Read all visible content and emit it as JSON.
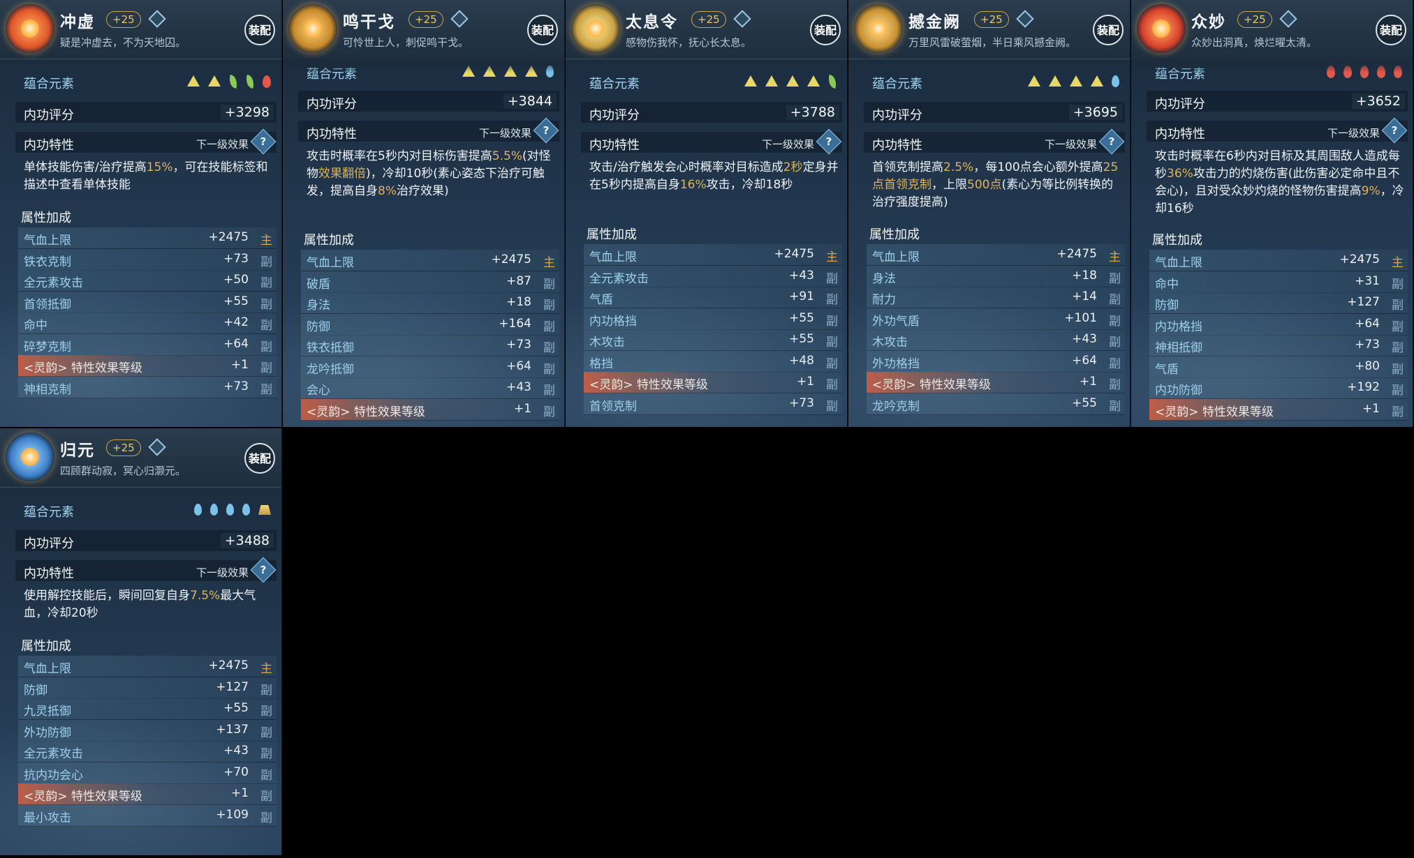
{
  "cards": [
    {
      "name": "冲虚",
      "level": "+25",
      "tagline": "疑是冲虚去，不为天地囚。",
      "equip": "装配",
      "element_label": "蕴合元素",
      "elements": [
        "tri",
        "tri",
        "leaf",
        "leaf",
        "fire"
      ],
      "score_label": "内功评分",
      "score": "+3298",
      "trait_label": "内功特性",
      "next_label": "下一级效果",
      "help": "?",
      "desc": [
        {
          "t": "单体技能伤害/治疗提高"
        },
        {
          "t": "15%",
          "h": true
        },
        {
          "t": "，可在技能标签和描述中查看单体技能"
        }
      ],
      "attr_label": "属性加成",
      "stats": [
        {
          "name": "气血上限",
          "value": "+2475",
          "tag": "主"
        },
        {
          "name": "铁衣克制",
          "value": "+73",
          "tag": "副"
        },
        {
          "name": "全元素攻击",
          "value": "+50",
          "tag": "副"
        },
        {
          "name": "首领抵御",
          "value": "+55",
          "tag": "副"
        },
        {
          "name": "命中",
          "value": "+42",
          "tag": "副"
        },
        {
          "name": "碎梦克制",
          "value": "+64",
          "tag": "副"
        },
        {
          "name": "<灵韵> 特性效果等级",
          "value": "+1",
          "tag": "副",
          "lingyun": true
        },
        {
          "name": "神相克制",
          "value": "+73",
          "tag": "副"
        }
      ]
    },
    {
      "name": "鸣干戈",
      "level": "+25",
      "tagline": "可怜世上人，刺促鸣干戈。",
      "equip": "装配",
      "element_label": "蕴合元素",
      "elements": [
        "tri",
        "tri",
        "tri",
        "tri",
        "drop"
      ],
      "score_label": "内功评分",
      "score": "+3844",
      "trait_label": "内功特性",
      "next_label": "下一级效果",
      "help": "?",
      "desc": [
        {
          "t": "攻击时概率在5秒内对目标伤害提高"
        },
        {
          "t": "5.5%",
          "h": true
        },
        {
          "t": "(对怪物"
        },
        {
          "t": "效果翻倍",
          "h": true
        },
        {
          "t": ")，冷却10秒(素心姿态下治疗可触发，提高自身"
        },
        {
          "t": "8%",
          "h": true
        },
        {
          "t": "治疗效果)"
        }
      ],
      "attr_label": "属性加成",
      "stats": [
        {
          "name": "气血上限",
          "value": "+2475",
          "tag": "主"
        },
        {
          "name": "破盾",
          "value": "+87",
          "tag": "副"
        },
        {
          "name": "身法",
          "value": "+18",
          "tag": "副"
        },
        {
          "name": "防御",
          "value": "+164",
          "tag": "副"
        },
        {
          "name": "铁衣抵御",
          "value": "+73",
          "tag": "副"
        },
        {
          "name": "龙吟抵御",
          "value": "+64",
          "tag": "副"
        },
        {
          "name": "会心",
          "value": "+43",
          "tag": "副"
        },
        {
          "name": "<灵韵> 特性效果等级",
          "value": "+1",
          "tag": "副",
          "lingyun": true
        }
      ]
    },
    {
      "name": "太息令",
      "level": "+25",
      "tagline": "感物伤我怀，抚心长太息。",
      "equip": "装配",
      "element_label": "蕴合元素",
      "elements": [
        "tri",
        "tri",
        "tri",
        "tri",
        "leaf"
      ],
      "score_label": "内功评分",
      "score": "+3788",
      "trait_label": "内功特性",
      "next_label": "下一级效果",
      "help": "?",
      "desc": [
        {
          "t": "攻击/治疗触发会心时概率对目标造成"
        },
        {
          "t": "2秒",
          "h": true
        },
        {
          "t": "定身并在5秒内提高自身"
        },
        {
          "t": "16%",
          "h": true
        },
        {
          "t": "攻击，冷却18秒"
        }
      ],
      "attr_label": "属性加成",
      "stats": [
        {
          "name": "气血上限",
          "value": "+2475",
          "tag": "主"
        },
        {
          "name": "全元素攻击",
          "value": "+43",
          "tag": "副"
        },
        {
          "name": "气盾",
          "value": "+91",
          "tag": "副"
        },
        {
          "name": "内功格挡",
          "value": "+55",
          "tag": "副"
        },
        {
          "name": "木攻击",
          "value": "+55",
          "tag": "副"
        },
        {
          "name": "格挡",
          "value": "+48",
          "tag": "副"
        },
        {
          "name": "<灵韵> 特性效果等级",
          "value": "+1",
          "tag": "副",
          "lingyun": true
        },
        {
          "name": "首领克制",
          "value": "+73",
          "tag": "副"
        }
      ]
    },
    {
      "name": "撼金阙",
      "level": "+25",
      "tagline": "万里风雷破萤烟，半日乘风撼金阙。",
      "equip": "装配",
      "element_label": "蕴合元素",
      "elements": [
        "tri",
        "tri",
        "tri",
        "tri",
        "drop"
      ],
      "score_label": "内功评分",
      "score": "+3695",
      "trait_label": "内功特性",
      "next_label": "下一级效果",
      "help": "?",
      "desc": [
        {
          "t": "首领克制提高"
        },
        {
          "t": "2.5%",
          "h": true
        },
        {
          "t": "，每100点会心额外提高"
        },
        {
          "t": "25点首领克制",
          "h": true
        },
        {
          "t": "，上限"
        },
        {
          "t": "500点",
          "h": true
        },
        {
          "t": "(素心为等比例转换的治疗强度提高)"
        }
      ],
      "attr_label": "属性加成",
      "stats": [
        {
          "name": "气血上限",
          "value": "+2475",
          "tag": "主"
        },
        {
          "name": "身法",
          "value": "+18",
          "tag": "副"
        },
        {
          "name": "耐力",
          "value": "+14",
          "tag": "副"
        },
        {
          "name": "外功气盾",
          "value": "+101",
          "tag": "副"
        },
        {
          "name": "木攻击",
          "value": "+43",
          "tag": "副"
        },
        {
          "name": "外功格挡",
          "value": "+64",
          "tag": "副"
        },
        {
          "name": "<灵韵> 特性效果等级",
          "value": "+1",
          "tag": "副",
          "lingyun": true
        },
        {
          "name": "龙吟克制",
          "value": "+55",
          "tag": "副"
        }
      ]
    },
    {
      "name": "众妙",
      "level": "+25",
      "tagline": "众妙出洞真，焕烂曜太清。",
      "equip": "装配",
      "element_label": "蕴合元素",
      "elements": [
        "fire",
        "fire",
        "fire",
        "fire",
        "fire"
      ],
      "score_label": "内功评分",
      "score": "+3652",
      "trait_label": "内功特性",
      "next_label": "下一级效果",
      "help": "?",
      "desc": [
        {
          "t": "攻击时概率在6秒内对目标及其周围敌人造成每秒"
        },
        {
          "t": "36%",
          "h": true
        },
        {
          "t": "攻击力的灼烧伤害(此伤害必定命中且不会心)，且对受众妙灼烧的怪物伤害提高"
        },
        {
          "t": "9%",
          "h": true
        },
        {
          "t": "，冷却16秒"
        }
      ],
      "attr_label": "属性加成",
      "stats": [
        {
          "name": "气血上限",
          "value": "+2475",
          "tag": "主"
        },
        {
          "name": "命中",
          "value": "+31",
          "tag": "副"
        },
        {
          "name": "防御",
          "value": "+127",
          "tag": "副"
        },
        {
          "name": "内功格挡",
          "value": "+64",
          "tag": "副"
        },
        {
          "name": "神相抵御",
          "value": "+73",
          "tag": "副"
        },
        {
          "name": "气盾",
          "value": "+80",
          "tag": "副"
        },
        {
          "name": "内功防御",
          "value": "+192",
          "tag": "副"
        },
        {
          "name": "<灵韵> 特性效果等级",
          "value": "+1",
          "tag": "副",
          "lingyun": true
        }
      ]
    },
    {
      "name": "归元",
      "level": "+25",
      "tagline": "四顾群动寂，冥心归灏元。",
      "equip": "装配",
      "element_label": "蕴合元素",
      "elements": [
        "drop",
        "drop",
        "drop",
        "drop",
        "stone"
      ],
      "score_label": "内功评分",
      "score": "+3488",
      "trait_label": "内功特性",
      "next_label": "下一级效果",
      "help": "?",
      "desc": [
        {
          "t": "使用解控技能后，瞬间回复自身"
        },
        {
          "t": "7.5%",
          "h": true
        },
        {
          "t": "最大气血，冷却20秒"
        }
      ],
      "attr_label": "属性加成",
      "stats": [
        {
          "name": "气血上限",
          "value": "+2475",
          "tag": "主"
        },
        {
          "name": "防御",
          "value": "+127",
          "tag": "副"
        },
        {
          "name": "九灵抵御",
          "value": "+55",
          "tag": "副"
        },
        {
          "name": "外功防御",
          "value": "+137",
          "tag": "副"
        },
        {
          "name": "全元素攻击",
          "value": "+43",
          "tag": "副"
        },
        {
          "name": "抗内功会心",
          "value": "+70",
          "tag": "副"
        },
        {
          "name": "<灵韵> 特性效果等级",
          "value": "+1",
          "tag": "副",
          "lingyun": true
        },
        {
          "name": "最小攻击",
          "value": "+109",
          "tag": "副"
        }
      ]
    }
  ]
}
